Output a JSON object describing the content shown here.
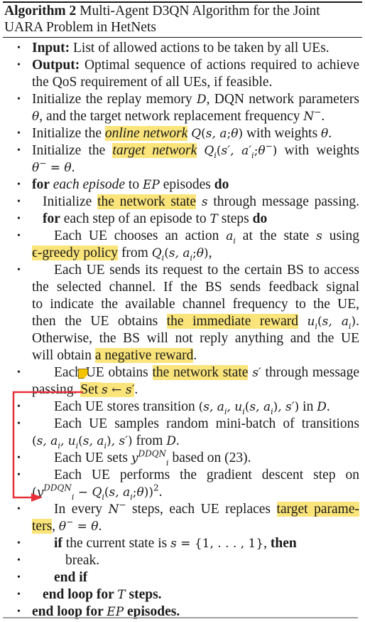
{
  "algorithm": {
    "label": "Algorithm 2",
    "title_line1": "Multi-Agent D3QN Algorithm for the Joint",
    "title_line2": "UARA Problem in HetNets"
  },
  "lines": [
    {
      "id": "input",
      "parts": [
        {
          "t": "Input:",
          "s": "b"
        },
        {
          "t": " List of allowed actions to be taken by all UEs."
        }
      ]
    },
    {
      "id": "output1",
      "parts": [
        {
          "t": "Output:",
          "s": "b"
        },
        {
          "t": " Optimal sequence of actions required to achieve"
        }
      ]
    },
    {
      "id": "output2",
      "parts": [
        {
          "t": "the QoS requirement of all UEs, if feasible."
        }
      ]
    },
    {
      "id": "init-replay1",
      "parts": [
        {
          "t": "Initialize the replay memory "
        },
        {
          "t": "D",
          "s": "cal"
        },
        {
          "t": ", DQN network parameters"
        }
      ]
    },
    {
      "id": "init-replay2",
      "parts": [
        {
          "t": "θ",
          "s": "m"
        },
        {
          "t": ", and the target network replacement frequency "
        },
        {
          "t": "N",
          "s": "m"
        },
        {
          "t": "−",
          "s": "sup"
        },
        {
          "t": "."
        }
      ]
    },
    {
      "id": "init-online",
      "parts": [
        {
          "t": "Initialize the "
        },
        {
          "t": "online network",
          "s": "i hl"
        },
        {
          "t": " "
        },
        {
          "t": "Q",
          "s": "m"
        },
        {
          "t": "(",
          "s": "mu"
        },
        {
          "t": "s, a",
          "s": "m"
        },
        {
          "t": ";",
          "s": "mu"
        },
        {
          "t": "θ",
          "s": "m"
        },
        {
          "t": ")",
          "s": "mu"
        },
        {
          "t": " with weights "
        },
        {
          "t": "θ",
          "s": "m"
        },
        {
          "t": "."
        }
      ]
    },
    {
      "id": "init-target1",
      "parts": [
        {
          "t": "Initialize the "
        },
        {
          "t": "target network",
          "s": "i hl"
        },
        {
          "t": " "
        },
        {
          "t": "Q",
          "s": "m"
        },
        {
          "t": "i",
          "s": "sub"
        },
        {
          "t": "(",
          "s": "mu"
        },
        {
          "t": "s′, a′",
          "s": "m"
        },
        {
          "t": "i",
          "s": "sub"
        },
        {
          "t": ";",
          "s": "mu"
        },
        {
          "t": "θ",
          "s": "m"
        },
        {
          "t": "−",
          "s": "sup"
        },
        {
          "t": ")",
          "s": "mu"
        },
        {
          "t": " with weights"
        }
      ]
    },
    {
      "id": "init-target2",
      "parts": [
        {
          "t": "θ",
          "s": "m"
        },
        {
          "t": "−",
          "s": "sup"
        },
        {
          "t": " = ",
          "s": "mu"
        },
        {
          "t": "θ",
          "s": "m"
        },
        {
          "t": "."
        }
      ]
    },
    {
      "id": "for-episode",
      "parts": [
        {
          "t": "for",
          "s": "b"
        },
        {
          "t": " "
        },
        {
          "t": "each episode",
          "s": "i"
        },
        {
          "t": " to "
        },
        {
          "t": "EP",
          "s": "m"
        },
        {
          "t": " episodes "
        },
        {
          "t": "do",
          "s": "b"
        }
      ]
    },
    {
      "id": "init-state",
      "parts": [
        {
          "t": "Initialize "
        },
        {
          "t": "the network state",
          "s": "hl"
        },
        {
          "t": " "
        },
        {
          "t": "s",
          "s": "m"
        },
        {
          "t": " through message passing."
        }
      ]
    },
    {
      "id": "for-step",
      "parts": [
        {
          "t": "for",
          "s": "b"
        },
        {
          "t": " each step of an episode to "
        },
        {
          "t": "T",
          "s": "m"
        },
        {
          "t": " steps "
        },
        {
          "t": "do",
          "s": "b"
        }
      ]
    },
    {
      "id": "choose1",
      "parts": [
        {
          "t": "Each UE chooses an action "
        },
        {
          "t": "a",
          "s": "m"
        },
        {
          "t": "i",
          "s": "sub"
        },
        {
          "t": " at the state "
        },
        {
          "t": "s",
          "s": "m"
        },
        {
          "t": " using"
        }
      ]
    },
    {
      "id": "choose2",
      "parts": [
        {
          "t": "ϵ-greedy policy",
          "s": "hl"
        },
        {
          "t": " from "
        },
        {
          "t": "Q",
          "s": "m"
        },
        {
          "t": "i",
          "s": "sub"
        },
        {
          "t": "(",
          "s": "mu"
        },
        {
          "t": "s, a",
          "s": "m"
        },
        {
          "t": "i",
          "s": "sub"
        },
        {
          "t": ";",
          "s": "mu"
        },
        {
          "t": "θ",
          "s": "m"
        },
        {
          "t": ")",
          "s": "mu"
        },
        {
          "t": ","
        }
      ]
    },
    {
      "id": "send1",
      "parts": [
        {
          "t": "Each UE sends its request to the certain BS to access"
        }
      ]
    },
    {
      "id": "send2",
      "parts": [
        {
          "t": "the selected channel. If the BS sends feedback signal"
        }
      ]
    },
    {
      "id": "send3",
      "parts": [
        {
          "t": "to indicate the available channel frequency to the UE,"
        }
      ]
    },
    {
      "id": "send4",
      "parts": [
        {
          "t": "then the UE obtains "
        },
        {
          "t": "the immediate reward",
          "s": "hl"
        },
        {
          "t": " "
        },
        {
          "t": "u",
          "s": "m"
        },
        {
          "t": "i",
          "s": "sub"
        },
        {
          "t": "(",
          "s": "mu"
        },
        {
          "t": "s, a",
          "s": "m"
        },
        {
          "t": "i",
          "s": "sub"
        },
        {
          "t": ")",
          "s": "mu"
        },
        {
          "t": "."
        }
      ]
    },
    {
      "id": "send5",
      "parts": [
        {
          "t": "Otherwise, the BS will not reply anything and the UE"
        }
      ]
    },
    {
      "id": "send6",
      "parts": [
        {
          "t": "will obtain "
        },
        {
          "t": "a negative reward",
          "s": "hl"
        },
        {
          "t": "."
        }
      ]
    },
    {
      "id": "obtain1",
      "parts": [
        {
          "t": "Each UE obtains "
        },
        {
          "t": "the network state",
          "s": "hl"
        },
        {
          "t": " "
        },
        {
          "t": "s′",
          "s": "m"
        },
        {
          "t": " through message"
        }
      ]
    },
    {
      "id": "obtain2",
      "parts": [
        {
          "t": "passing. "
        },
        {
          "t": "Set ",
          "s": "hl"
        },
        {
          "t": "s ← s′",
          "s": "m hl"
        },
        {
          "t": "."
        }
      ]
    },
    {
      "id": "store",
      "parts": [
        {
          "t": "Each UE stores transition "
        },
        {
          "t": "(",
          "s": "mu"
        },
        {
          "t": "s, a",
          "s": "m"
        },
        {
          "t": "i",
          "s": "sub"
        },
        {
          "t": ", u",
          "s": "m"
        },
        {
          "t": "i",
          "s": "sub"
        },
        {
          "t": "(",
          "s": "mu"
        },
        {
          "t": "s, a",
          "s": "m"
        },
        {
          "t": "i",
          "s": "sub"
        },
        {
          "t": ")",
          "s": "mu"
        },
        {
          "t": ", s′",
          "s": "m"
        },
        {
          "t": ")",
          "s": "mu"
        },
        {
          "t": " in "
        },
        {
          "t": "D",
          "s": "cal"
        },
        {
          "t": "."
        }
      ]
    },
    {
      "id": "sample1",
      "parts": [
        {
          "t": "Each UE samples random mini-batch of transitions"
        }
      ]
    },
    {
      "id": "sample2",
      "parts": [
        {
          "t": "(",
          "s": "mu"
        },
        {
          "t": "s, a",
          "s": "m"
        },
        {
          "t": "i",
          "s": "sub"
        },
        {
          "t": ", u",
          "s": "m"
        },
        {
          "t": "i",
          "s": "sub"
        },
        {
          "t": "(",
          "s": "mu"
        },
        {
          "t": "s, a",
          "s": "m"
        },
        {
          "t": "i",
          "s": "sub"
        },
        {
          "t": ")",
          "s": "mu"
        },
        {
          "t": ", s′",
          "s": "m"
        },
        {
          "t": ")",
          "s": "mu"
        },
        {
          "t": " from "
        },
        {
          "t": "D",
          "s": "cal"
        },
        {
          "t": "."
        }
      ]
    },
    {
      "id": "sets",
      "parts": [
        {
          "t": "Each UE sets "
        },
        {
          "t": "y",
          "s": "m"
        },
        {
          "t": "DDQN",
          "s": "supi"
        },
        {
          "t": "i",
          "s": "sub"
        },
        {
          "t": " based on (23)."
        }
      ]
    },
    {
      "id": "grad1",
      "parts": [
        {
          "t": "Each UE performs the gradient descent step on"
        }
      ]
    },
    {
      "id": "grad2",
      "parts": [
        {
          "t": "(",
          "s": "mu"
        },
        {
          "t": "y",
          "s": "m"
        },
        {
          "t": "DDQN",
          "s": "supi"
        },
        {
          "t": "i",
          "s": "sub"
        },
        {
          "t": " − ",
          "s": "mu"
        },
        {
          "t": "Q",
          "s": "m"
        },
        {
          "t": "i",
          "s": "sub"
        },
        {
          "t": "(",
          "s": "mu"
        },
        {
          "t": "s, a",
          "s": "m"
        },
        {
          "t": "i",
          "s": "sub"
        },
        {
          "t": ";",
          "s": "mu"
        },
        {
          "t": "θ",
          "s": "m"
        },
        {
          "t": "))",
          "s": "mu"
        },
        {
          "t": "2",
          "s": "supn"
        },
        {
          "t": "."
        }
      ]
    },
    {
      "id": "replace1",
      "parts": [
        {
          "t": "In every "
        },
        {
          "t": "N",
          "s": "m"
        },
        {
          "t": "−",
          "s": "sup"
        },
        {
          "t": " steps, each UE replaces "
        },
        {
          "t": "target parame-",
          "s": "hl"
        }
      ]
    },
    {
      "id": "replace2",
      "parts": [
        {
          "t": "ters",
          "s": "hl"
        },
        {
          "t": ", "
        },
        {
          "t": "θ",
          "s": "m"
        },
        {
          "t": "−",
          "s": "sup"
        },
        {
          "t": " = ",
          "s": "mu"
        },
        {
          "t": "θ",
          "s": "m"
        },
        {
          "t": "."
        }
      ]
    },
    {
      "id": "if",
      "parts": [
        {
          "t": "if",
          "s": "b"
        },
        {
          "t": " the current state is "
        },
        {
          "t": "s",
          "s": "m"
        },
        {
          "t": " = {1, . . . , 1}",
          "s": "mu"
        },
        {
          "t": ", "
        },
        {
          "t": "then",
          "s": "b"
        }
      ]
    },
    {
      "id": "break",
      "parts": [
        {
          "t": "break."
        }
      ]
    },
    {
      "id": "end-if",
      "parts": [
        {
          "t": "end if",
          "s": "b"
        }
      ]
    },
    {
      "id": "end-loop-t",
      "parts": [
        {
          "t": "end loop for ",
          "s": "b"
        },
        {
          "t": "T",
          "s": "m"
        },
        {
          "t": " steps.",
          "s": "b"
        }
      ]
    },
    {
      "id": "end-loop-ep",
      "parts": [
        {
          "t": "end loop for ",
          "s": "b"
        },
        {
          "t": "EP",
          "s": "m"
        },
        {
          "t": " episodes.",
          "s": "b"
        }
      ]
    }
  ],
  "colors": {
    "highlight": "#fbe57a",
    "annotation_arrow": "#e8303a",
    "note_icon": "#f5c400"
  }
}
